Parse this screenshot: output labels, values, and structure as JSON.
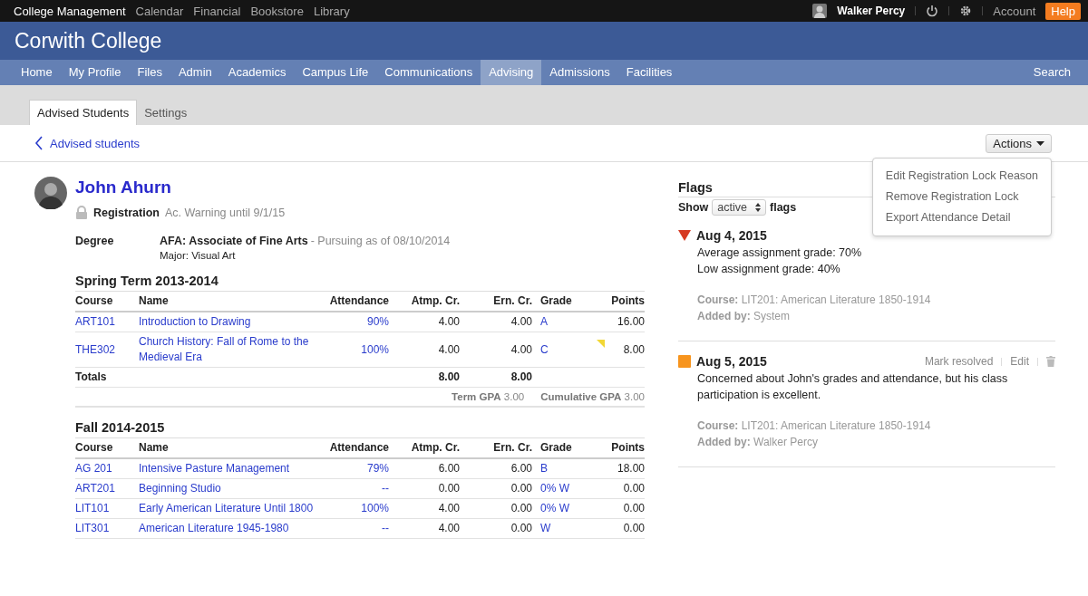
{
  "top_bar": {
    "app": "College Management",
    "links": [
      "Calendar",
      "Financial",
      "Bookstore",
      "Library"
    ],
    "user": "Walker Percy",
    "account": "Account",
    "help": "Help"
  },
  "header": {
    "title": "Corwith College"
  },
  "nav": {
    "items": [
      {
        "label": "Home",
        "selected": false
      },
      {
        "label": "My Profile",
        "selected": false
      },
      {
        "label": "Files",
        "selected": false
      },
      {
        "label": "Admin",
        "selected": false
      },
      {
        "label": "Academics",
        "selected": false
      },
      {
        "label": "Campus Life",
        "selected": false
      },
      {
        "label": "Communications",
        "selected": false
      },
      {
        "label": "Advising",
        "selected": true
      },
      {
        "label": "Admissions",
        "selected": false
      },
      {
        "label": "Facilities",
        "selected": false
      }
    ],
    "search": "Search"
  },
  "tabs": [
    {
      "label": "Advised Students",
      "selected": true
    },
    {
      "label": "Settings",
      "selected": false
    }
  ],
  "back_link": "Advised students",
  "actions": {
    "label": "Actions",
    "menu": [
      "Edit Registration Lock Reason",
      "Remove Registration Lock",
      "Export Attendance Detail"
    ]
  },
  "student": {
    "name": "John Ahurn",
    "lock_label": "Registration",
    "lock_note": "Ac. Warning until 9/1/15",
    "degree_label": "Degree",
    "degree": "AFA: Associate of Fine Arts",
    "degree_status": "- Pursuing as of 08/10/2014",
    "major": "Major: Visual Art"
  },
  "terms": [
    {
      "title": "Spring Term 2013-2014",
      "columns": [
        "Course",
        "Name",
        "Attendance",
        "Atmp. Cr.",
        "Ern. Cr.",
        "Grade",
        "Points"
      ],
      "rows": [
        {
          "course": "ART101",
          "name": "Introduction to Drawing",
          "attendance": "90%",
          "atmp": "4.00",
          "ern": "4.00",
          "grade": "A",
          "points": "16.00",
          "flagged": false
        },
        {
          "course": "THE302",
          "name": "Church History: Fall of Rome to the Medieval Era",
          "attendance": "100%",
          "atmp": "4.00",
          "ern": "4.00",
          "grade": "C",
          "points": "8.00",
          "flagged": true
        }
      ],
      "totals": {
        "label": "Totals",
        "atmp": "8.00",
        "ern": "8.00"
      },
      "gpa": [
        {
          "label": "Term GPA",
          "value": "3.00"
        },
        {
          "label": "Cumulative GPA",
          "value": "3.00"
        }
      ]
    },
    {
      "title": "Fall 2014-2015",
      "columns": [
        "Course",
        "Name",
        "Attendance",
        "Atmp. Cr.",
        "Ern. Cr.",
        "Grade",
        "Points"
      ],
      "rows": [
        {
          "course": "AG 201",
          "name": "Intensive Pasture Management",
          "attendance": "79%",
          "atmp": "6.00",
          "ern": "6.00",
          "grade": "B",
          "points": "18.00",
          "flagged": false
        },
        {
          "course": "ART201",
          "name": "Beginning Studio",
          "attendance": "--",
          "atmp": "0.00",
          "ern": "0.00",
          "grade": "0% W",
          "points": "0.00",
          "flagged": false
        },
        {
          "course": "LIT101",
          "name": "Early American Literature Until 1800",
          "attendance": "100%",
          "atmp": "4.00",
          "ern": "0.00",
          "grade": "0% W",
          "points": "0.00",
          "flagged": false
        },
        {
          "course": "LIT301",
          "name": "American Literature 1945-1980",
          "attendance": "--",
          "atmp": "4.00",
          "ern": "0.00",
          "grade": "W",
          "points": "0.00",
          "flagged": false
        }
      ]
    }
  ],
  "flags": {
    "title": "Flags",
    "show_label": "Show",
    "filter": "active",
    "suffix": "flags",
    "items": [
      {
        "kind": "triangle",
        "color": "#d63a22",
        "date": "Aug 4, 2015",
        "lines": [
          "Average assignment grade: 70%",
          "Low assignment grade: 40%"
        ],
        "course_label": "Course:",
        "course": "LIT201: American Literature 1850-1914",
        "added_label": "Added by:",
        "added": "System"
      },
      {
        "kind": "square",
        "color": "#f7941d",
        "date": "Aug 5, 2015",
        "lines": [
          "Concerned about John's grades and attendance, but his class participation is excellent."
        ],
        "course_label": "Course:",
        "course": "LIT201: American Literature 1850-1914",
        "added_label": "Added by:",
        "added": "Walker Percy",
        "actions": [
          "Mark resolved",
          "Edit"
        ],
        "deletable": true
      }
    ]
  }
}
